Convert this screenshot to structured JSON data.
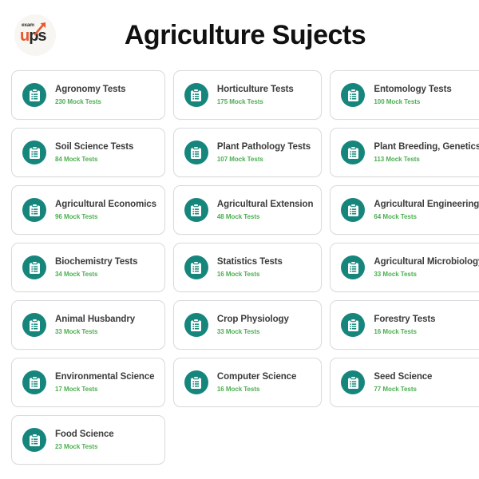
{
  "header": {
    "title": "Agriculture Sujects",
    "logo": {
      "top_text": "exam",
      "main_text_accent": "u",
      "main_text_rest": "ps",
      "arrow_icon": "rising-arrow-icon"
    }
  },
  "colors": {
    "icon_circle": "#16867d",
    "subtitle_green": "#4caf50",
    "title_dark": "#3c3c3c",
    "card_border": "#d8dadd",
    "page_background": "#ffffff",
    "logo_accent": "#e8582a"
  },
  "cards": [
    {
      "icon": "clipboard-list-icon",
      "title": "Agronomy Tests",
      "count": "230 Mock Tests"
    },
    {
      "icon": "clipboard-list-icon",
      "title": "Horticulture Tests",
      "count": "175 Mock Tests"
    },
    {
      "icon": "clipboard-list-icon",
      "title": "Entomology Tests",
      "count": "100 Mock Tests"
    },
    {
      "icon": "clipboard-list-icon",
      "title": "Soil Science Tests",
      "count": "84 Mock Tests"
    },
    {
      "icon": "clipboard-list-icon",
      "title": "Plant Pathology Tests",
      "count": "107 Mock Tests"
    },
    {
      "icon": "clipboard-list-icon",
      "title": "Plant Breeding, Genetics",
      "count": "113 Mock Tests"
    },
    {
      "icon": "clipboard-list-icon",
      "title": "Agricultural Economics",
      "count": "96 Mock Tests"
    },
    {
      "icon": "clipboard-list-icon",
      "title": "Agricultural Extension",
      "count": "48 Mock Tests"
    },
    {
      "icon": "clipboard-list-icon",
      "title": "Agricultural Engineering",
      "count": "64 Mock Tests"
    },
    {
      "icon": "clipboard-list-icon",
      "title": "Biochemistry Tests",
      "count": "34 Mock Tests"
    },
    {
      "icon": "clipboard-list-icon",
      "title": "Statistics Tests",
      "count": "16 Mock Tests"
    },
    {
      "icon": "clipboard-list-icon",
      "title": "Agricultural Microbiology",
      "count": "33 Mock Tests"
    },
    {
      "icon": "clipboard-list-icon",
      "title": "Animal Husbandry",
      "count": "33 Mock Tests"
    },
    {
      "icon": "clipboard-list-icon",
      "title": "Crop Physiology",
      "count": "33 Mock Tests"
    },
    {
      "icon": "clipboard-list-icon",
      "title": "Forestry Tests",
      "count": "16 Mock Tests"
    },
    {
      "icon": "clipboard-list-icon",
      "title": "Environmental Science",
      "count": "17 Mock Tests"
    },
    {
      "icon": "clipboard-list-icon",
      "title": "Computer Science",
      "count": "16 Mock Tests"
    },
    {
      "icon": "clipboard-list-icon",
      "title": "Seed Science",
      "count": "77 Mock Tests"
    },
    {
      "icon": "clipboard-list-icon",
      "title": "Food Science",
      "count": "23 Mock Tests"
    }
  ]
}
